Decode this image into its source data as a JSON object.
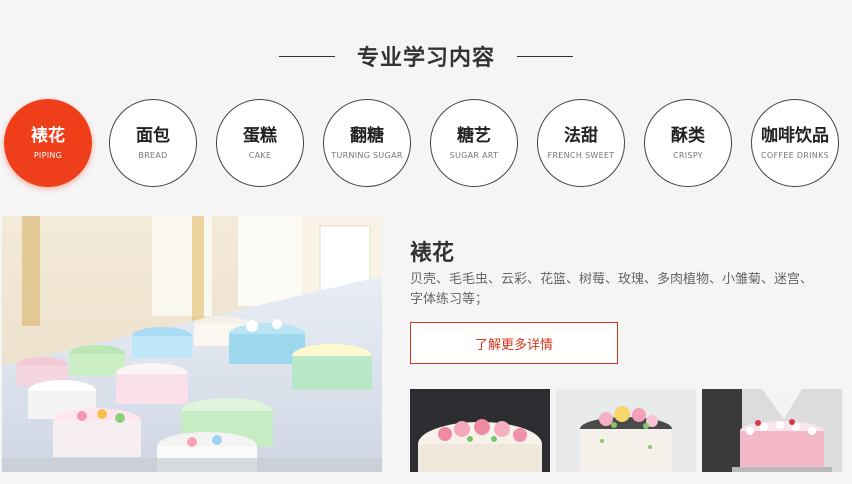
{
  "section": {
    "title": "专业学习内容"
  },
  "tabs": [
    {
      "cn": "裱花",
      "en": "PIPING",
      "active": true
    },
    {
      "cn": "面包",
      "en": "BREAD"
    },
    {
      "cn": "蛋糕",
      "en": "CAKE"
    },
    {
      "cn": "翻糖",
      "en": "TURNING SUGAR"
    },
    {
      "cn": "糖艺",
      "en": "SUGAR ART"
    },
    {
      "cn": "法甜",
      "en": "FRENCH SWEET"
    },
    {
      "cn": "酥类",
      "en": "CRISPY"
    },
    {
      "cn": "咖啡饮品",
      "en": "COFFEE DRINKS"
    }
  ],
  "detail": {
    "title": "裱花",
    "description": "贝壳、毛毛虫、云彩、花篮、树莓、玫瑰、多肉植物、小雏菊、迷宫、字体练习等；",
    "more_label": "了解更多详情"
  },
  "colors": {
    "accent": "#ef3e1a",
    "button_border": "#d6361c"
  }
}
